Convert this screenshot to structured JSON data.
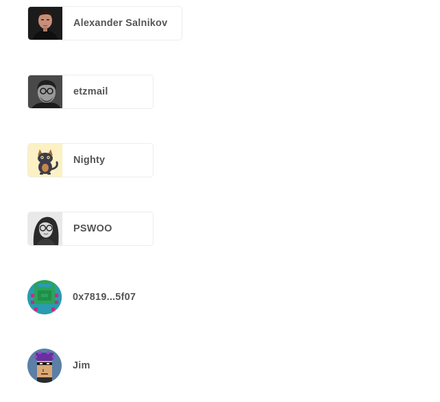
{
  "users": [
    {
      "name": "Alexander Salnikov",
      "avatar": "portrait-dark-avatar"
    },
    {
      "name": "etzmail",
      "avatar": "portrait-bw-avatar"
    },
    {
      "name": "Nighty",
      "avatar": "cat-illustration-avatar"
    },
    {
      "name": "PSWOO",
      "avatar": "portrait-glasses-avatar"
    },
    {
      "name": "0x7819...5f07",
      "avatar": "pixel-pattern-avatar"
    },
    {
      "name": "Jim",
      "avatar": "cryptopunk-avatar"
    }
  ],
  "colors": {
    "name_text": "#555555",
    "chip_border": "#ececec",
    "pixel_avatar_green": "#2aa35a",
    "pixel_avatar_teal": "#2a9bb0",
    "pixel_avatar_magenta": "#d0287f",
    "punk_background": "#5b7fa6",
    "punk_hair": "#6a2fa0"
  }
}
